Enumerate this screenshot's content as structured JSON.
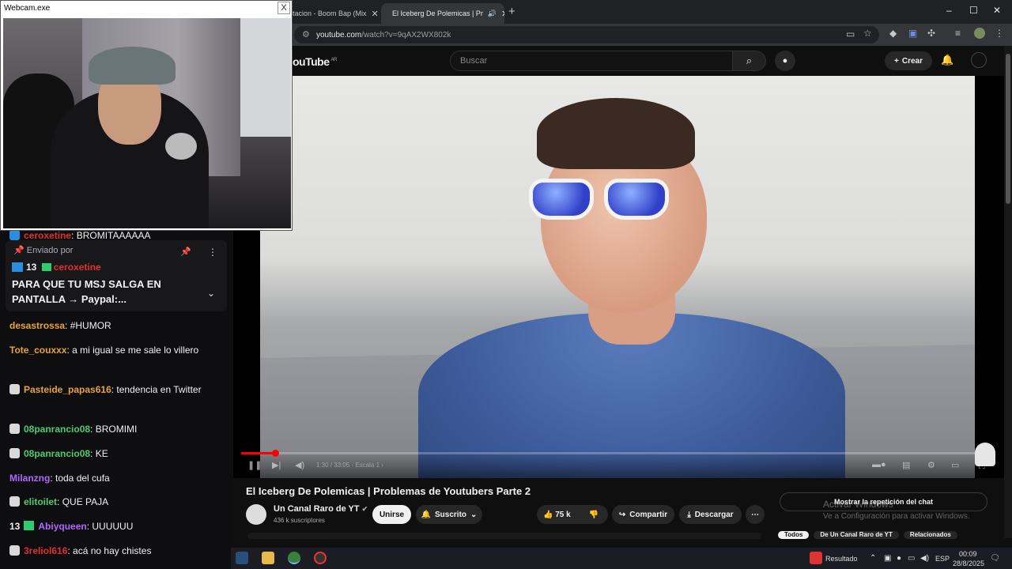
{
  "webcam": {
    "title": "Webcam.exe",
    "close": "X"
  },
  "browser": {
    "tabs": [
      {
        "label": "tacion - Boom Bap (Mix",
        "close": "✕"
      },
      {
        "label": "El Iceberg De Polemicas | Pr",
        "close": "✕",
        "audio": "🔊"
      }
    ],
    "new_tab": "+",
    "window_controls": {
      "minimize": "–",
      "maximize": "☐",
      "close": "✕"
    },
    "url_host": "youtube.com",
    "url_path": "/watch?v=9qAX2WX802k"
  },
  "youtube": {
    "logo": "ouTube",
    "region": "AR",
    "search_placeholder": "Buscar",
    "create_label": "Crear",
    "video": {
      "progress_fraction": 0.045,
      "time": "1:30 / 33:05 · Escala 1 ›"
    },
    "title": "El Iceberg De Polemicas | Problemas de Youtubers Parte 2",
    "channel": {
      "name": "Un Canal Raro de YT",
      "verified": "✔",
      "subscribers": "436 k suscriptores"
    },
    "buttons": {
      "join": "Unirse",
      "subscribed": "Suscrito",
      "likes": "75 k",
      "share": "Compartir",
      "download": "Descargar",
      "more": "⋯"
    },
    "chat_replay": "Mostrar la repetición del chat",
    "chips": [
      "Todos",
      "De Un Canal Raro de YT",
      "Relacionados"
    ]
  },
  "windows_watermark": {
    "line1": "Activar Windows",
    "line2": "Ve a Configuración para activar Windows."
  },
  "chat": {
    "top_partial": "BROMITAAAAAA",
    "top_partial_user": "ceroxetine",
    "pinned": {
      "label": "Enviado por",
      "badge_count": "13",
      "user": "ceroxetine",
      "message": "PARA QUE TU MSJ SALGA EN PANTALLA → Paypal:..."
    },
    "messages": [
      {
        "user": "desastrossa",
        "color": "#e8a33a",
        "text": "#HUMOR",
        "badge": ""
      },
      {
        "user": "Tote_couxxx",
        "color": "#e8a33a",
        "text": "a mi igual se me sale lo villero",
        "badge": ""
      },
      {
        "user": "Pasteide_papas616",
        "color": "#e8a33a",
        "text": "tendencia en Twitter",
        "badge": "mod"
      },
      {
        "user": "08panrancio08",
        "color": "#4ecb71",
        "text": "BROMIMI",
        "badge": "mod"
      },
      {
        "user": "08panrancio08",
        "color": "#4ecb71",
        "text": "KE",
        "badge": "mod"
      },
      {
        "user": "Milanzng",
        "color": "#b266ff",
        "text": "toda del cufa",
        "badge": ""
      },
      {
        "user": "elitoilet",
        "color": "#4ecb71",
        "text": "QUE PAJA",
        "badge": "mod"
      },
      {
        "user": "Abiyqueen",
        "color": "#b266ff",
        "text": "UUUUUU",
        "badge": "13"
      },
      {
        "user": "3reliol616",
        "color": "#e0302f",
        "text": "acá no hay chistes",
        "badge": "mod"
      }
    ]
  },
  "taskbar": {
    "search_result": "Resultado",
    "lang": "ESP",
    "time": "00:09",
    "date": "28/8/2025"
  },
  "colors": {
    "accent_red": "#ff0000",
    "chat_bg": "#0e0e10",
    "yt_bg": "#0f0f0f"
  }
}
